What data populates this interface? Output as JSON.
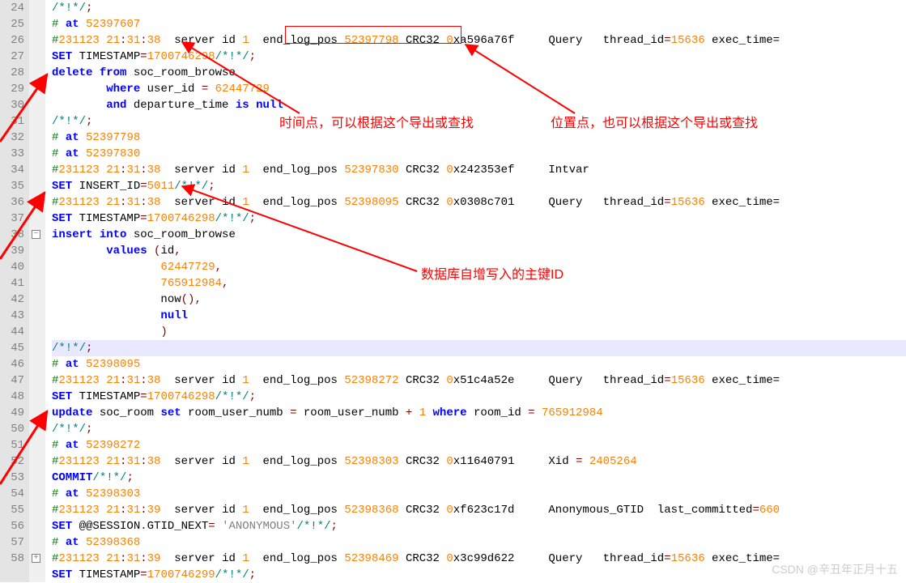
{
  "gutter_start": 24,
  "gutter_count": 35,
  "fold_marks": [
    {
      "line": 38,
      "sym": "−"
    },
    {
      "line": 58,
      "sym": "+"
    }
  ],
  "annotations": {
    "time_label": "时间点，可以根据这个导出或查找",
    "pos_label": "位置点，也可以根据这个导出或查找",
    "id_label": "数据库自增写入的主键ID"
  },
  "watermark": "CSDN @辛丑年正月十五",
  "highlight_line_index": 21,
  "lines": [
    {
      "html": "<span class='c-cm2'>/*!*/</span><span class='c-punc'>;</span>"
    },
    {
      "html": "<span class='c-comment'># </span><span class='c-kw'>at</span> <span class='c-num'>52397607</span>"
    },
    {
      "html": "<span class='c-comment'>#</span><span class='c-num'>231123 21</span><span class='c-punc'>:</span><span class='c-num'>31</span><span class='c-punc'>:</span><span class='c-num'>38</span>  server id <span class='c-num'>1</span>  end_log_pos <span class='c-num'>52397798</span> CRC32 <span class='c-num'>0</span>xa596a76f     Query   thread_id<span class='c-punc'>=</span><span class='c-num'>15636</span> exec_time="
    },
    {
      "html": "<span class='c-kw'>SET</span> TIMESTAMP<span class='c-punc'>=</span><span class='c-num'>1700746298</span><span class='c-cm2'>/*!*/</span><span class='c-punc'>;</span>"
    },
    {
      "html": "<span class='c-kw'>delete</span> <span class='c-kw'>from</span> soc_room_browse"
    },
    {
      "html": "        <span class='c-kw'>where</span> user_id <span class='c-punc'>=</span> <span class='c-num'>62447729</span>"
    },
    {
      "html": "        <span class='c-kw'>and</span> departure_time <span class='c-kw'>is</span> <span class='c-kw'>null</span>"
    },
    {
      "html": "<span class='c-cm2'>/*!*/</span><span class='c-punc'>;</span>"
    },
    {
      "html": "<span class='c-comment'># </span><span class='c-kw'>at</span> <span class='c-num'>52397798</span>"
    },
    {
      "html": "<span class='c-comment'># </span><span class='c-kw'>at</span> <span class='c-num'>52397830</span>"
    },
    {
      "html": "<span class='c-comment'>#</span><span class='c-num'>231123 21</span><span class='c-punc'>:</span><span class='c-num'>31</span><span class='c-punc'>:</span><span class='c-num'>38</span>  server id <span class='c-num'>1</span>  end_log_pos <span class='c-num'>52397830</span> CRC32 <span class='c-num'>0</span>x242353ef     Intvar"
    },
    {
      "html": "<span class='c-kw'>SET</span> INSERT_ID<span class='c-punc'>=</span><span class='c-num'>5011</span><span class='c-cm2'>/*!*/</span><span class='c-punc'>;</span>"
    },
    {
      "html": "<span class='c-comment'>#</span><span class='c-num'>231123 21</span><span class='c-punc'>:</span><span class='c-num'>31</span><span class='c-punc'>:</span><span class='c-num'>38</span>  server id <span class='c-num'>1</span>  end_log_pos <span class='c-num'>52398095</span> CRC32 <span class='c-num'>0</span>x0308c701     Query   thread_id<span class='c-punc'>=</span><span class='c-num'>15636</span> exec_time="
    },
    {
      "html": "<span class='c-kw'>SET</span> TIMESTAMP<span class='c-punc'>=</span><span class='c-num'>1700746298</span><span class='c-cm2'>/*!*/</span><span class='c-punc'>;</span>"
    },
    {
      "html": "<span class='c-kw'>insert</span> <span class='c-kw'>into</span> soc_room_browse"
    },
    {
      "html": "        <span class='c-kw'>values</span> <span class='c-punc'>(</span>id<span class='c-punc'>,</span>"
    },
    {
      "html": "                <span class='c-num'>62447729</span><span class='c-punc'>,</span>"
    },
    {
      "html": "                <span class='c-num'>765912984</span><span class='c-punc'>,</span>"
    },
    {
      "html": "                now<span class='c-punc'>(),</span>"
    },
    {
      "html": "                <span class='c-kw'>null</span>"
    },
    {
      "html": "                <span class='c-punc'>)</span>"
    },
    {
      "html": "<span class='c-cm2'>/*!*/</span><span class='c-punc'>;</span>"
    },
    {
      "html": "<span class='c-comment'># </span><span class='c-kw'>at</span> <span class='c-num'>52398095</span>"
    },
    {
      "html": "<span class='c-comment'>#</span><span class='c-num'>231123 21</span><span class='c-punc'>:</span><span class='c-num'>31</span><span class='c-punc'>:</span><span class='c-num'>38</span>  server id <span class='c-num'>1</span>  end_log_pos <span class='c-num'>52398272</span> CRC32 <span class='c-num'>0</span>x51c4a52e     Query   thread_id<span class='c-punc'>=</span><span class='c-num'>15636</span> exec_time="
    },
    {
      "html": "<span class='c-kw'>SET</span> TIMESTAMP<span class='c-punc'>=</span><span class='c-num'>1700746298</span><span class='c-cm2'>/*!*/</span><span class='c-punc'>;</span>"
    },
    {
      "html": "<span class='c-kw'>update</span> soc_room <span class='c-kw'>set</span> room_user_numb <span class='c-punc'>=</span> room_user_numb <span class='c-punc'>+</span> <span class='c-num'>1</span> <span class='c-kw'>where</span> room_id <span class='c-punc'>=</span> <span class='c-num'>765912984</span>"
    },
    {
      "html": "<span class='c-cm2'>/*!*/</span><span class='c-punc'>;</span>"
    },
    {
      "html": "<span class='c-comment'># </span><span class='c-kw'>at</span> <span class='c-num'>52398272</span>"
    },
    {
      "html": "<span class='c-comment'>#</span><span class='c-num'>231123 21</span><span class='c-punc'>:</span><span class='c-num'>31</span><span class='c-punc'>:</span><span class='c-num'>38</span>  server id <span class='c-num'>1</span>  end_log_pos <span class='c-num'>52398303</span> CRC32 <span class='c-num'>0</span>x11640791     Xid <span class='c-punc'>=</span> <span class='c-num'>2405264</span>"
    },
    {
      "html": "<span class='c-kw'>COMMIT</span><span class='c-cm2'>/*!*/</span><span class='c-punc'>;</span>"
    },
    {
      "html": "<span class='c-comment'># </span><span class='c-kw'>at</span> <span class='c-num'>52398303</span>"
    },
    {
      "html": "<span class='c-comment'>#</span><span class='c-num'>231123 21</span><span class='c-punc'>:</span><span class='c-num'>31</span><span class='c-punc'>:</span><span class='c-num'>39</span>  server id <span class='c-num'>1</span>  end_log_pos <span class='c-num'>52398368</span> CRC32 <span class='c-num'>0</span>xf623c17d     Anonymous_GTID  last_committed<span class='c-punc'>=</span><span class='c-num'>660</span>"
    },
    {
      "html": "<span class='c-kw'>SET</span> @@SESSION<span class='c-punc'>.</span>GTID_NEXT<span class='c-punc'>=</span> <span class='c-grey'>'ANONYMOUS'</span><span class='c-cm2'>/*!*/</span><span class='c-punc'>;</span>"
    },
    {
      "html": "<span class='c-comment'># </span><span class='c-kw'>at</span> <span class='c-num'>52398368</span>"
    },
    {
      "html": "<span class='c-comment'>#</span><span class='c-num'>231123 21</span><span class='c-punc'>:</span><span class='c-num'>31</span><span class='c-punc'>:</span><span class='c-num'>39</span>  server id <span class='c-num'>1</span>  end_log_pos <span class='c-num'>52398469</span> CRC32 <span class='c-num'>0</span>x3c99d622     Query   thread_id<span class='c-punc'>=</span><span class='c-num'>15636</span> exec_time="
    },
    {
      "html": "<span class='c-kw'>SET</span> TIMESTAMP<span class='c-punc'>=</span><span class='c-num'>1700746299</span><span class='c-cm2'>/*!*/</span><span class='c-punc'>;</span>"
    }
  ]
}
